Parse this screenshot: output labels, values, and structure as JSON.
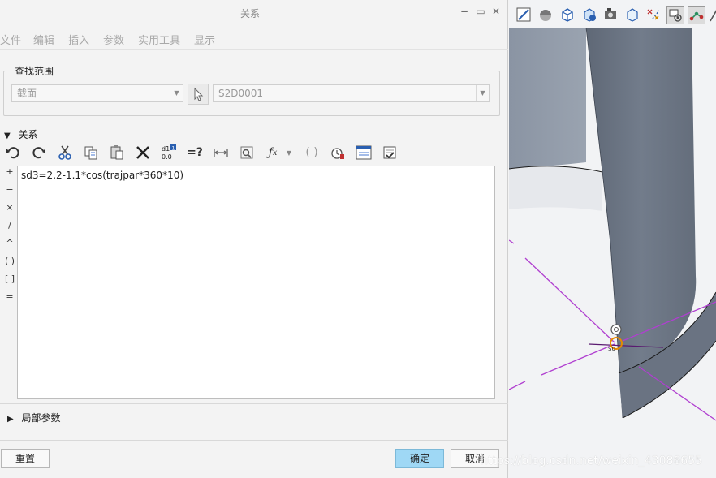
{
  "window": {
    "title": "关系"
  },
  "menu": [
    "文件",
    "编辑",
    "插入",
    "参数",
    "实用工具",
    "显示"
  ],
  "lookup": {
    "group_label": "查找范围",
    "scope_value": "截面",
    "item_value": "S2D0001"
  },
  "relations": {
    "section_label": "关系",
    "text": "sd3=2.2-1.1*cos(trajpar*360*10)"
  },
  "operators": [
    "+",
    "−",
    "×",
    "/",
    "^",
    "( )",
    "[ ]",
    "="
  ],
  "local_params": {
    "section_label": "局部参数"
  },
  "buttons": {
    "reset": "重置",
    "ok": "确定",
    "cancel": "取消"
  },
  "watermark": "https://blog.csdn.net/weixin_43086655",
  "viewport": {
    "cursor_label": "S0"
  },
  "colors": {
    "ok_button": "#9fd8f5",
    "model_surface": "#7b8594",
    "datum_axis": "#b03fd0"
  }
}
